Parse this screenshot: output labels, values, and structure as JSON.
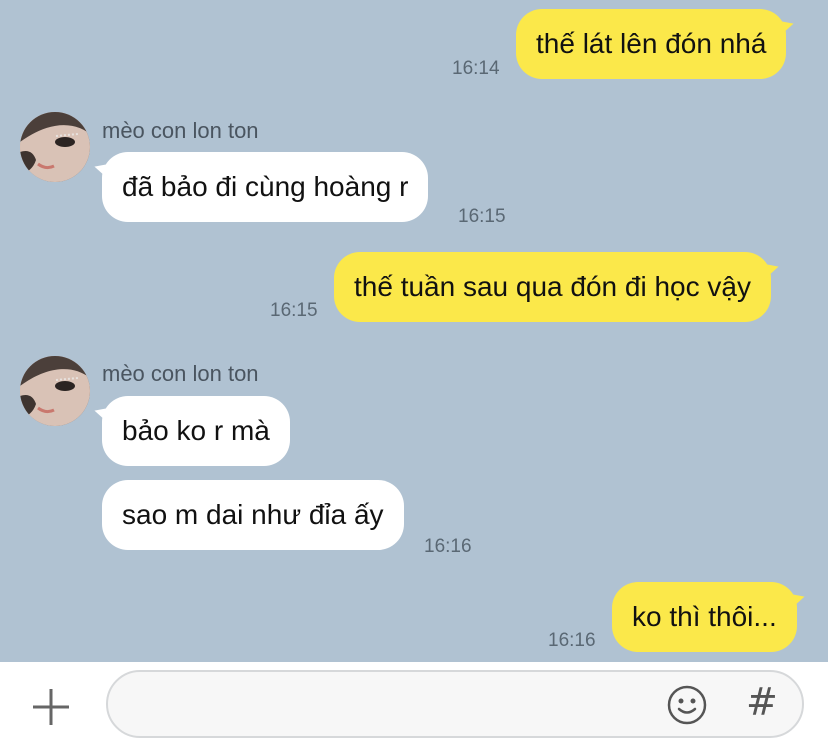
{
  "messages": [
    {
      "direction": "out",
      "text": "thế lát lên đón nhá",
      "time": "16:14"
    },
    {
      "direction": "in",
      "sender": "mèo con lon ton",
      "text": "đã bảo đi cùng hoàng r",
      "time": "16:15"
    },
    {
      "direction": "out",
      "text": "thế tuần sau qua đón đi học vậy",
      "time": "16:15"
    },
    {
      "direction": "in",
      "sender": "mèo con lon ton",
      "text": "bảo ko r mà"
    },
    {
      "direction": "in",
      "text": "sao m dai như đỉa ấy",
      "time": "16:16"
    },
    {
      "direction": "out",
      "text": "ko thì thôi...",
      "time": "16:16"
    }
  ],
  "input": {
    "placeholder": "",
    "value": ""
  },
  "icons": {
    "add": "plus-icon",
    "emoji": "emoji-icon",
    "hashtag": "hashtag-icon"
  },
  "hash_symbol": "#",
  "colors": {
    "chat_background": "#b0c2d2",
    "outgoing_bubble": "#fbe84a",
    "incoming_bubble": "#ffffff"
  }
}
